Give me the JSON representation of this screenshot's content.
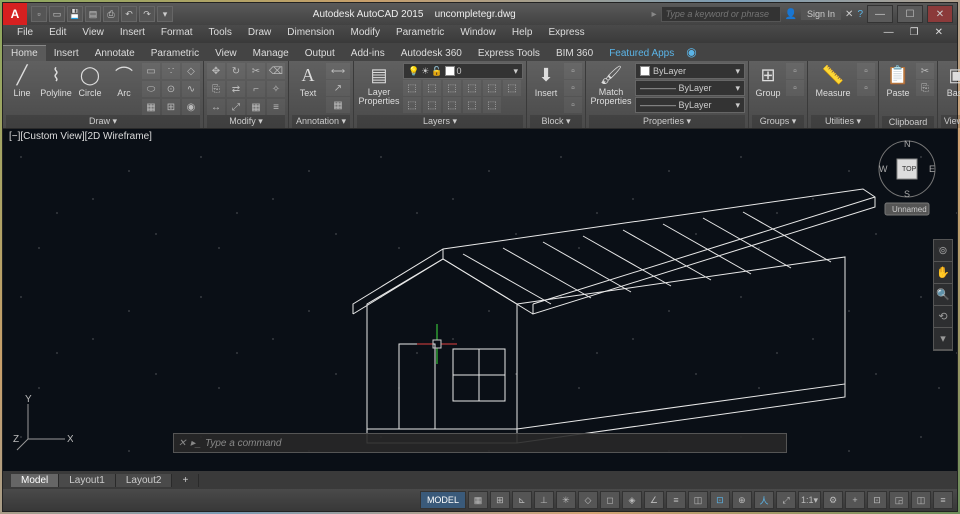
{
  "app": {
    "title": "Autodesk AutoCAD 2015",
    "doc": "uncompletegr.dwg",
    "search_placeholder": "Type a keyword or phrase",
    "signin": "Sign In"
  },
  "menu": [
    "File",
    "Edit",
    "View",
    "Insert",
    "Format",
    "Tools",
    "Draw",
    "Dimension",
    "Modify",
    "Parametric",
    "Window",
    "Help",
    "Express"
  ],
  "tabs": [
    "Home",
    "Insert",
    "Annotate",
    "Parametric",
    "View",
    "Manage",
    "Output",
    "Add-ins",
    "Autodesk 360",
    "Express Tools",
    "BIM 360",
    "Featured Apps"
  ],
  "ribbon": {
    "draw": {
      "title": "Draw ▾",
      "items": [
        "Line",
        "Polyline",
        "Circle",
        "Arc"
      ]
    },
    "modify": {
      "title": "Modify ▾"
    },
    "annotation": {
      "title": "Annotation ▾",
      "text": "Text"
    },
    "layers": {
      "title": "Layers ▾",
      "layerprops": "Layer\nProperties",
      "current": "0"
    },
    "block": {
      "title": "Block ▾",
      "insert": "Insert"
    },
    "properties": {
      "title": "Properties ▾",
      "match": "Match\nProperties",
      "bylayer": "ByLayer"
    },
    "groups": {
      "title": "Groups ▾",
      "group": "Group"
    },
    "utilities": {
      "title": "Utilities ▾",
      "measure": "Measure"
    },
    "clipboard": {
      "title": "Clipboard",
      "paste": "Paste"
    },
    "view": {
      "title": "View ▾",
      "base": "Base"
    }
  },
  "viewport": {
    "label": "[−][Custom View][2D Wireframe]"
  },
  "viewcube": {
    "top": "TOP",
    "n": "N",
    "s": "S",
    "e": "E",
    "w": "W",
    "unnamed": "Unnamed"
  },
  "ucs": {
    "x": "X",
    "y": "Y",
    "z": "Z"
  },
  "cmd": {
    "prompt": "Type a command"
  },
  "layouts": [
    "Model",
    "Layout1",
    "Layout2"
  ],
  "status": {
    "model": "MODEL",
    "scale": "1:1"
  }
}
